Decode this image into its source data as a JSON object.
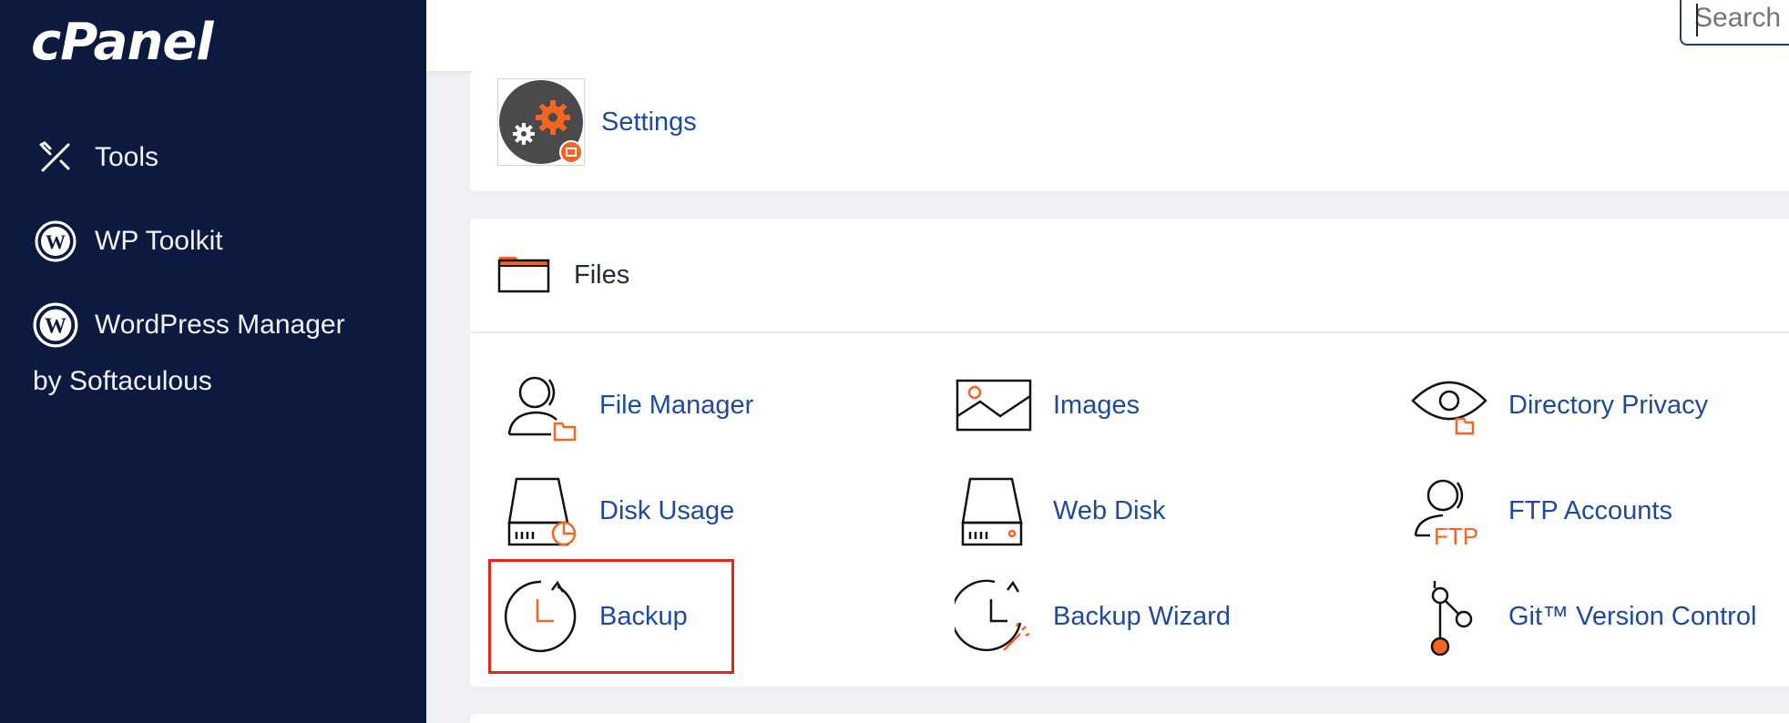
{
  "sidebar": {
    "logo": "cPanel",
    "items": [
      {
        "label": "Tools",
        "icon": "tools-icon"
      },
      {
        "label": "WP Toolkit",
        "icon": "wordpress-icon"
      },
      {
        "label": "WordPress Manager",
        "sub": "by Softaculous",
        "icon": "wordpress-icon"
      }
    ]
  },
  "topbar": {
    "search_placeholder": "Search"
  },
  "settings": {
    "label": "Settings",
    "icon": "settings-gears-icon"
  },
  "files": {
    "title": "Files",
    "icon": "folder-icon",
    "tools": [
      {
        "label": "File Manager",
        "icon": "file-manager-icon"
      },
      {
        "label": "Images",
        "icon": "images-icon"
      },
      {
        "label": "Directory Privacy",
        "icon": "directory-privacy-icon"
      },
      {
        "label": "Disk Usage",
        "icon": "disk-usage-icon"
      },
      {
        "label": "Web Disk",
        "icon": "web-disk-icon"
      },
      {
        "label": "FTP Accounts",
        "icon": "ftp-accounts-icon",
        "icon_text": "FTP"
      },
      {
        "label": "Backup",
        "icon": "backup-icon",
        "highlighted": true
      },
      {
        "label": "Backup Wizard",
        "icon": "backup-wizard-icon"
      },
      {
        "label": "Git™ Version Control",
        "icon": "git-icon"
      }
    ]
  },
  "colors": {
    "sidebar": "#0c1a3f",
    "link": "#1f4a9c",
    "accent": "#f26522",
    "highlight": "#e0291b"
  }
}
